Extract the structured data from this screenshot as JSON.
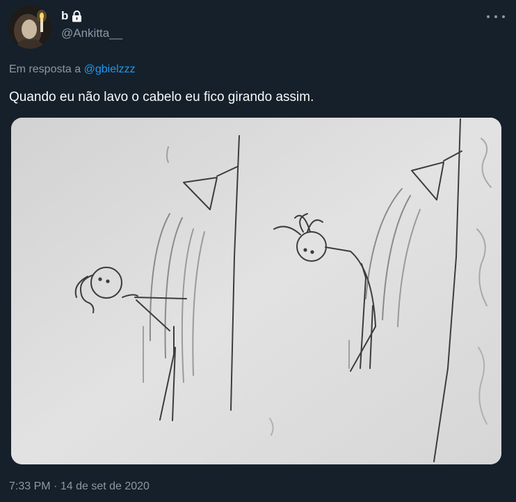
{
  "user": {
    "display_name": "b",
    "handle": "@Ankitta__",
    "protected_icon": "lock-icon",
    "avatar_icon": "avatar-photo"
  },
  "tweet": {
    "reply_prefix": "Em resposta a",
    "reply_to": "@gbielzzz",
    "text": "Quando eu não lavo o cabelo eu fico girando assim.",
    "media_description": "pencil drawing",
    "time": "7:33 PM",
    "separator": "·",
    "date": "14 de set de 2020"
  },
  "colors": {
    "background": "#15202b",
    "text": "#f7f9f9",
    "secondary": "#8b98a5",
    "link": "#1d9bf0"
  },
  "icons": {
    "more": "more-horizontal-icon",
    "lock": "lock-icon"
  }
}
